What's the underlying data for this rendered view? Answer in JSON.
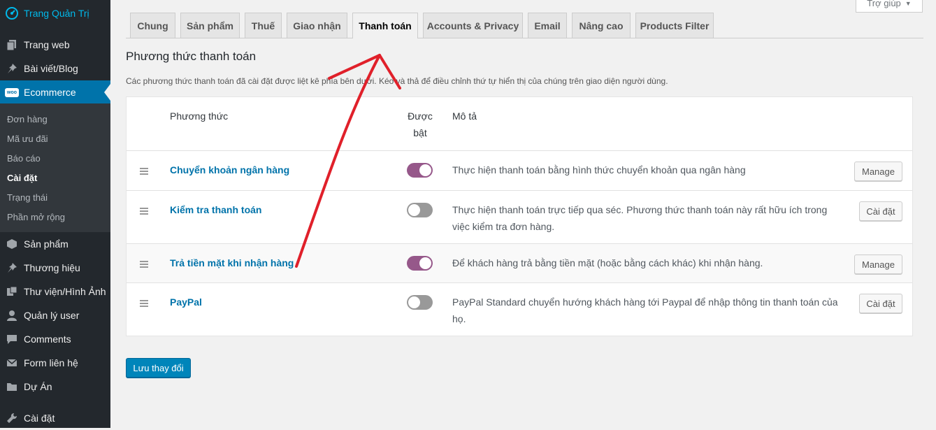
{
  "sidebar": {
    "brand": "Trang Quản Trị",
    "items": [
      {
        "label": "Trang web",
        "icon": "pages-icon"
      },
      {
        "label": "Bài viết/Blog",
        "icon": "pin-icon"
      },
      {
        "label": "Ecommerce",
        "icon": "woo-icon",
        "icon_text": "woo"
      },
      {
        "label": "Sản phẩm",
        "icon": "box-icon"
      },
      {
        "label": "Thương hiệu",
        "icon": "pin-icon"
      },
      {
        "label": "Thư viện/Hình Ảnh",
        "icon": "media-icon"
      },
      {
        "label": "Quản lý user",
        "icon": "user-icon"
      },
      {
        "label": "Comments",
        "icon": "comment-icon"
      },
      {
        "label": "Form liên hệ",
        "icon": "mail-icon"
      },
      {
        "label": "Dự Án",
        "icon": "folder-icon"
      },
      {
        "label": "Cài đặt",
        "icon": "wrench-icon"
      }
    ],
    "submenu": [
      "Đơn hàng",
      "Mã ưu đãi",
      "Báo cáo",
      "Cài đặt",
      "Trạng thái",
      "Phần mở rộng"
    ],
    "active_submenu": "Cài đặt"
  },
  "help": {
    "label": "Trợ giúp"
  },
  "tabs": [
    "Chung",
    "Sản phẩm",
    "Thuế",
    "Giao nhận",
    "Thanh toán",
    "Accounts & Privacy",
    "Email",
    "Nâng cao",
    "Products Filter"
  ],
  "active_tab": "Thanh toán",
  "section": {
    "title": "Phương thức thanh toán",
    "description": "Các phương thức thanh toán đã cài đặt được liệt kê phía bên dưới. Kéo và thả để điều chỉnh thứ tự hiển thị của chúng trên giao diện người dùng."
  },
  "table": {
    "headers": {
      "method": "Phương thức",
      "enabled_line1": "Được",
      "enabled_line2": "bật",
      "description": "Mô tả"
    },
    "rows": [
      {
        "name": "Chuyển khoản ngân hàng",
        "enabled": true,
        "description": "Thực hiện thanh toán bằng hình thức chuyển khoản qua ngân hàng",
        "action": "Manage"
      },
      {
        "name": "Kiểm tra thanh toán",
        "enabled": false,
        "description": "Thực hiện thanh toán trực tiếp qua séc. Phương thức thanh toán này rất hữu ích trong việc kiểm tra đơn hàng.",
        "action": "Cài đặt"
      },
      {
        "name": "Trả tiền mặt khi nhận hàng",
        "enabled": true,
        "description": "Để khách hàng trả bằng tiền mặt (hoặc bằng cách khác) khi nhận hàng.",
        "action": "Manage"
      },
      {
        "name": "PayPal",
        "enabled": false,
        "description": "PayPal Standard chuyển hướng khách hàng tới Paypal để nhập thông tin thanh toán của họ.",
        "action": "Cài đặt"
      }
    ]
  },
  "save_label": "Lưu thay đổi",
  "colors": {
    "accent": "#0073aa",
    "toggle_on": "#96588a",
    "annotation": "#e0202a"
  }
}
